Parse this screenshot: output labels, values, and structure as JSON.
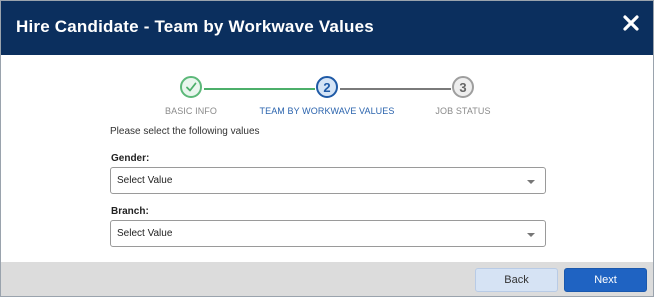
{
  "dialog": {
    "title": "Hire Candidate - Team by Workwave Values",
    "close_icon": "close-icon"
  },
  "stepper": {
    "steps": [
      {
        "number": "1",
        "label": "BASIC INFO",
        "state": "completed",
        "icon": "check-icon"
      },
      {
        "number": "2",
        "label": "TEAM BY WORKWAVE VALUES",
        "state": "active"
      },
      {
        "number": "3",
        "label": "JOB STATUS",
        "state": "pending"
      }
    ]
  },
  "form": {
    "instruction": "Please select the following values",
    "gender": {
      "label": "Gender:",
      "value": "Select Value"
    },
    "branch": {
      "label": "Branch:",
      "value": "Select Value"
    }
  },
  "footer": {
    "back_label": "Back",
    "next_label": "Next"
  },
  "colors": {
    "header": "#0b2f5e",
    "accent": "#1f63c2",
    "completed": "#4caf6a",
    "footer": "#dcdcdc"
  }
}
